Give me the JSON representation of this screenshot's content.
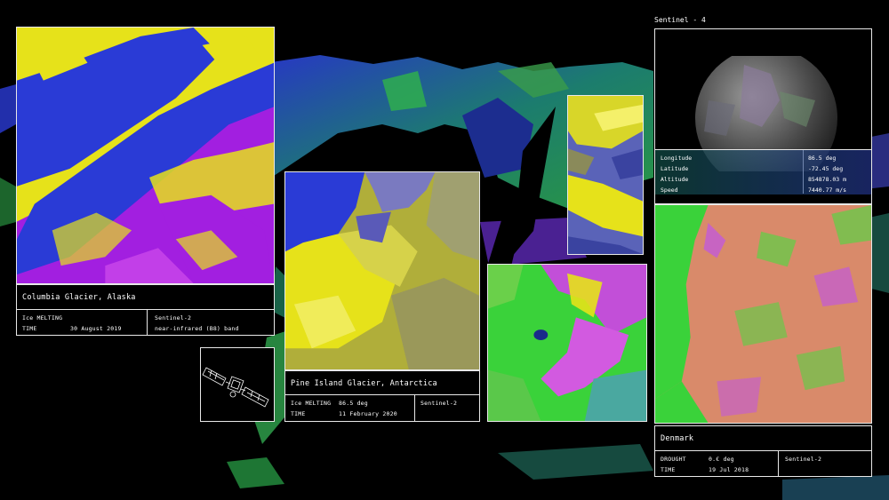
{
  "panels": {
    "columbia": {
      "title": "Columbia Glacier, Alaska",
      "metric_label": "Ice MELTING",
      "time_label": "TIME",
      "time_value": "30 August 2019",
      "satellite": "Sentinel-2",
      "band": "near-infrared (B8) band"
    },
    "pine": {
      "title": "Pine Island Glacier, Antarctica",
      "metric_label": "Ice MELTING",
      "metric_value": "86.5 deg",
      "time_label": "TIME",
      "time_value": "11 February 2020",
      "satellite": "Sentinel-2"
    },
    "sentinel4": {
      "title": "Sentinel - 4",
      "rows": [
        {
          "label": "Longitude",
          "value": "86.5 deg"
        },
        {
          "label": "Latitude",
          "value": "-72.45 deg"
        },
        {
          "label": "Altitude",
          "value": "854878.03 m"
        },
        {
          "label": "Speed",
          "value": "7440.77 m/s"
        }
      ]
    },
    "denmark": {
      "title": "Denmark",
      "metric_label": "DROUGHT",
      "metric_value": "0.€ deg",
      "time_label": "TIME",
      "time_value": "19 Jul 2018",
      "satellite": "Sentinel-2"
    }
  },
  "icons": {
    "satellite": "satellite-icon",
    "globe": "globe-icon"
  },
  "colors": {
    "background": "#000000",
    "border": "#e8e8e8",
    "yellow": "#e6e21a",
    "magenta": "#a21fe0",
    "blue": "#2a3bd6",
    "green": "#3ad23a",
    "salmon": "#d98a6a"
  }
}
